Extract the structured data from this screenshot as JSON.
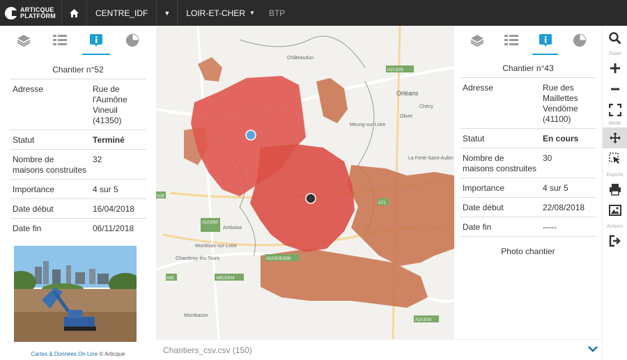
{
  "app": {
    "logo_line1": "ARTICQUE",
    "logo_line2": "PLATFORM"
  },
  "topbar": {
    "region": "CENTRE_IDF",
    "department": "LOIR-ET-CHER",
    "theme": "BTP"
  },
  "colors": {
    "accent": "#1a9ed6",
    "topbar": "#2b2b2b",
    "map_red": "#e06a60",
    "map_brown": "#c8714a"
  },
  "left_panel": {
    "title": "Chantier n°52",
    "rows": [
      {
        "label": "Adresse",
        "value": "Rue de l'Aumône Vineuil (41350)"
      },
      {
        "label": "Statut",
        "value": "Terminé"
      },
      {
        "label": "Nombre de maisons construites",
        "value": "32"
      },
      {
        "label": "Importance",
        "value": "4 sur 5"
      },
      {
        "label": "Date début",
        "value": "16/04/2018"
      },
      {
        "label": "Date fin",
        "value": "06/11/2018"
      }
    ],
    "credits_link": "Cartes & Données On Line",
    "credits_rest": "© Articque"
  },
  "right_panel": {
    "title": "Chantier n°43",
    "rows": [
      {
        "label": "Adresse",
        "value": "Rue des Maillettes Vendôme (41100)"
      },
      {
        "label": "Statut",
        "value": "En cours"
      },
      {
        "label": "Nombre de maisons construites",
        "value": "30"
      },
      {
        "label": "Importance",
        "value": "4 sur 5"
      },
      {
        "label": "Date début",
        "value": "22/08/2018"
      },
      {
        "label": "Date fin",
        "value": "-----"
      }
    ],
    "photo_label": "Photo chantier"
  },
  "map": {
    "places": [
      "Châteaudun",
      "Orléans",
      "Olivet",
      "Chécy",
      "Meung-sur-Loire",
      "La Ferté-Saint-Aubin",
      "Amboise",
      "Chambray-lès-Tours",
      "Montlouis-sur-Loire",
      "Montbazon"
    ],
    "roads": [
      "A10;E05",
      "A10;E60",
      "A10;E05;E60",
      "A85",
      "A85;E604",
      "A20;E09",
      "A28",
      "A71"
    ]
  },
  "bottom": {
    "dataset": "Chantiers_csv.csv (150)"
  },
  "toolbar": {
    "zoom_label": "Zoom",
    "mode_label": "Mode",
    "exports_label": "Exports",
    "actions_label": "Actions"
  }
}
